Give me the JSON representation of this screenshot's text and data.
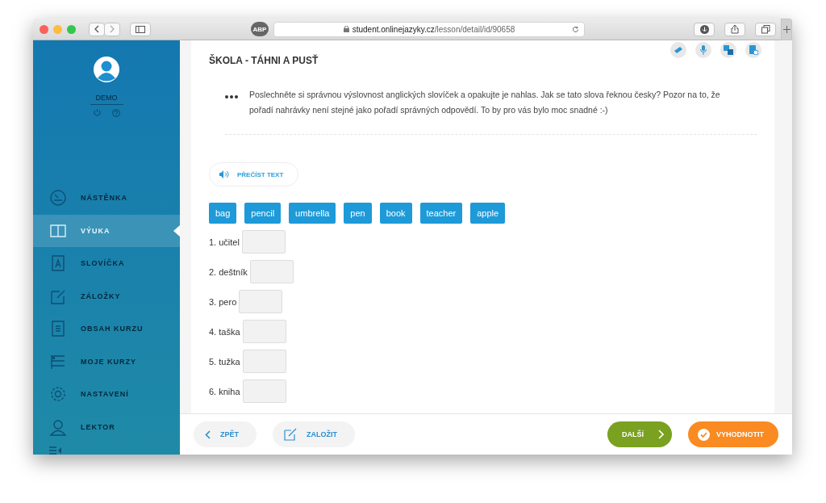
{
  "browser": {
    "url": "**student.onlinejazyky.cz**/lesson/detail/id/90658",
    "adblock": "ABP"
  },
  "sidebar": {
    "user": "DEMO",
    "items": [
      {
        "label": "NÁSTĚNKA",
        "selected": false
      },
      {
        "label": "VÝUKA",
        "selected": true
      },
      {
        "label": "SLOVÍČKA",
        "selected": false
      },
      {
        "label": "ZÁLOŽKY",
        "selected": false
      },
      {
        "label": "OBSAH KURZU",
        "selected": false
      },
      {
        "label": "MOJE KURZY",
        "selected": false
      },
      {
        "label": "NASTAVENÍ",
        "selected": false
      },
      {
        "label": "LEKTOR",
        "selected": false
      }
    ]
  },
  "lesson": {
    "title": "ŠKOLA - TÁHNI A PUSŤ",
    "instruction": "Poslechněte si správnou výslovnost anglických slovíček a opakujte je nahlas. Jak se tato slova řeknou česky? Pozor na to, že pořadí nahrávky není stejné jako pořadí správných odpovědí. To by pro vás bylo moc snadné :-)",
    "read_button": "PŘEČÍST TEXT",
    "words": [
      "bag",
      "pencil",
      "umbrella",
      "pen",
      "book",
      "teacher",
      "apple"
    ],
    "answers": [
      "1. učitel",
      "2. deštník",
      "3. pero",
      "4. taška",
      "5. tužka",
      "6. kniha"
    ]
  },
  "footer": {
    "back": "ZPĚT",
    "bookmark": "ZALOŽIT",
    "next": "DALŠÍ",
    "evaluate": "VYHODNOTIT"
  }
}
